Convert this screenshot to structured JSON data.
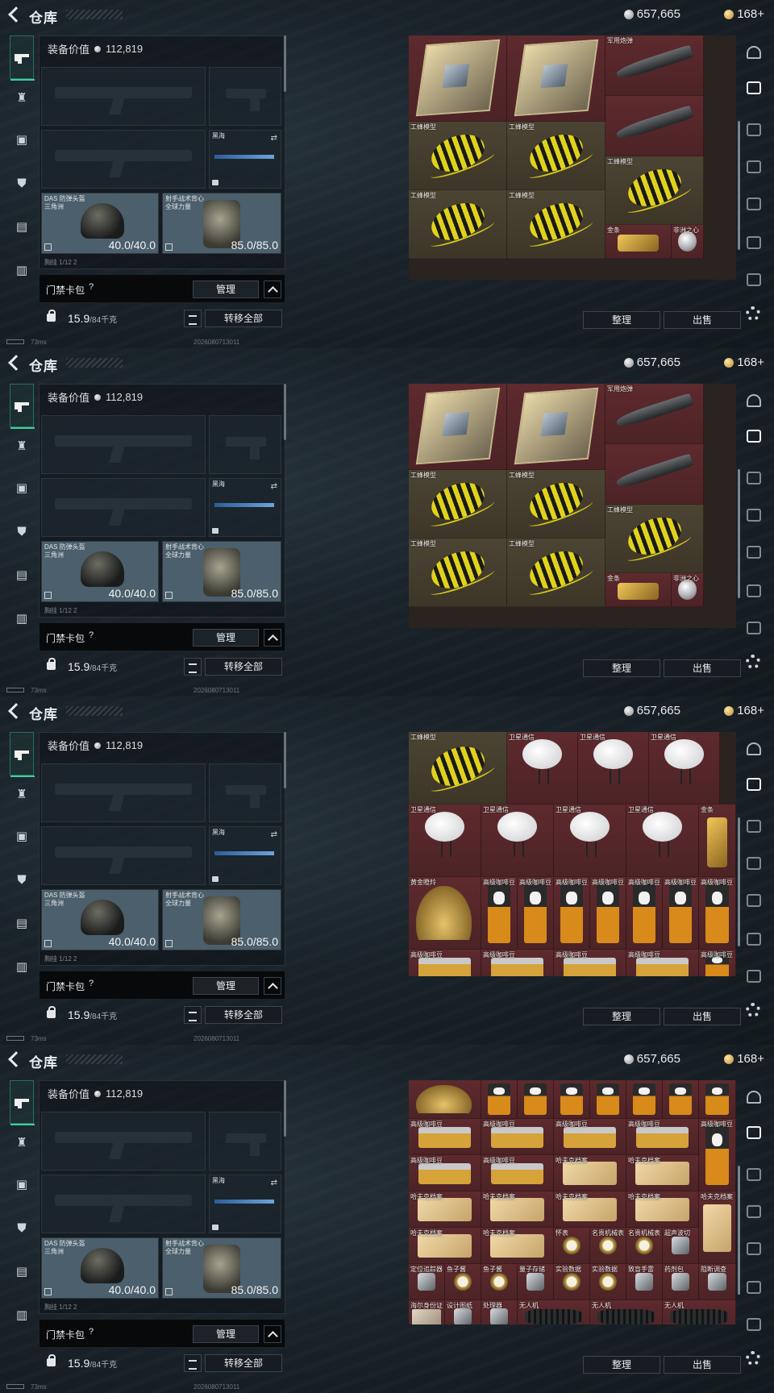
{
  "header": {
    "title": "仓库",
    "silver": "657,665",
    "gold": "168+"
  },
  "loadout": {
    "equip_value_label": "装备价值",
    "equip_value": "112,819",
    "melee_label": "黑海",
    "helmet_label": "DAS 防弹头盔\n三角洲",
    "helmet_durability": "40.0/40.0",
    "armor_label": "射手战术背心\n全球力量",
    "armor_durability": "85.0/85.0",
    "cut_row_text": "胸挂 1/12 2"
  },
  "gate": {
    "label": "门禁卡包",
    "help": "?",
    "manage": "管理"
  },
  "weight": {
    "value": "15.9",
    "max": "/84千克",
    "transfer": "转移全部"
  },
  "status": {
    "ping": "73ms",
    "build": "2026080713011"
  },
  "stash_buttons": {
    "sort": "整理",
    "sell": "出售"
  },
  "colors": {
    "accent": "#3fd0a0",
    "rarity_red": "#5e2a2e",
    "rarity_gold": "#4c4433"
  },
  "icons": {
    "left_nav": [
      "gun-icon",
      "backpack-icon",
      "chest-rig-icon",
      "armor-icon",
      "case-icon",
      "briefcase-icon"
    ],
    "right_rail": [
      "safebox-icon",
      "stash-tab-1-icon",
      "stash-tab-2-icon",
      "stash-tab-3-icon",
      "stash-tab-4-icon",
      "stash-tab-5-icon",
      "stash-tab-6-icon"
    ],
    "settings": "gear-icon"
  },
  "frames": [
    {
      "cells": [
        {
          "l": 0,
          "t": 0,
          "w": 122,
          "h": 107,
          "c": "red",
          "a": "cpu",
          "label": ""
        },
        {
          "l": 122,
          "t": 0,
          "w": 122,
          "h": 107,
          "c": "red",
          "a": "cpu",
          "label": ""
        },
        {
          "l": 244,
          "t": 0,
          "w": 122,
          "h": 75,
          "c": "red",
          "a": "missile",
          "label": "军用炮弹"
        },
        {
          "l": 244,
          "t": 75,
          "w": 122,
          "h": 75,
          "c": "red",
          "a": "missile",
          "label": ""
        },
        {
          "l": 0,
          "t": 107,
          "w": 122,
          "h": 85,
          "c": "gold",
          "a": "wasp",
          "label": "工蜂模型"
        },
        {
          "l": 122,
          "t": 107,
          "w": 122,
          "h": 85,
          "c": "gold",
          "a": "wasp",
          "label": "工蜂模型"
        },
        {
          "l": 244,
          "t": 150,
          "w": 122,
          "h": 85,
          "c": "gold",
          "a": "wasp",
          "label": "工蜂模型"
        },
        {
          "l": 0,
          "t": 192,
          "w": 122,
          "h": 85,
          "c": "gold",
          "a": "wasp",
          "label": "工蜂模型"
        },
        {
          "l": 122,
          "t": 192,
          "w": 122,
          "h": 85,
          "c": "gold",
          "a": "wasp",
          "label": "工蜂模型"
        },
        {
          "l": 244,
          "t": 235,
          "w": 82,
          "h": 42,
          "c": "red",
          "a": "goldbar",
          "label": "金条"
        },
        {
          "l": 326,
          "t": 235,
          "w": 40,
          "h": 42,
          "c": "red",
          "a": "diamond",
          "label": "非洲之心"
        }
      ]
    },
    {
      "cells": [
        {
          "l": 0,
          "t": 0,
          "w": 122,
          "h": 107,
          "c": "red",
          "a": "cpu",
          "label": ""
        },
        {
          "l": 122,
          "t": 0,
          "w": 122,
          "h": 107,
          "c": "red",
          "a": "cpu",
          "label": ""
        },
        {
          "l": 244,
          "t": 0,
          "w": 122,
          "h": 75,
          "c": "red",
          "a": "missile",
          "label": "军用炮弹"
        },
        {
          "l": 244,
          "t": 75,
          "w": 122,
          "h": 75,
          "c": "red",
          "a": "missile",
          "label": ""
        },
        {
          "l": 0,
          "t": 107,
          "w": 122,
          "h": 85,
          "c": "gold",
          "a": "wasp",
          "label": "工蜂模型"
        },
        {
          "l": 122,
          "t": 107,
          "w": 122,
          "h": 85,
          "c": "gold",
          "a": "wasp",
          "label": "工蜂模型"
        },
        {
          "l": 244,
          "t": 150,
          "w": 122,
          "h": 85,
          "c": "gold",
          "a": "wasp",
          "label": "工蜂模型"
        },
        {
          "l": 0,
          "t": 192,
          "w": 122,
          "h": 85,
          "c": "gold",
          "a": "wasp",
          "label": "工蜂模型"
        },
        {
          "l": 122,
          "t": 192,
          "w": 122,
          "h": 85,
          "c": "gold",
          "a": "wasp",
          "label": "工蜂模型"
        },
        {
          "l": 244,
          "t": 235,
          "w": 82,
          "h": 42,
          "c": "red",
          "a": "goldbar",
          "label": "金条"
        },
        {
          "l": 326,
          "t": 235,
          "w": 40,
          "h": 42,
          "c": "red",
          "a": "diamond",
          "label": "非洲之心"
        }
      ]
    },
    {
      "cells": [
        {
          "l": 0,
          "t": 0,
          "w": 122,
          "h": 90,
          "c": "gold",
          "a": "wasp",
          "label": "工蜂模型"
        },
        {
          "l": 122,
          "t": 0,
          "w": 88,
          "h": 90,
          "c": "red",
          "a": "dish",
          "label": "卫星通信"
        },
        {
          "l": 210,
          "t": 0,
          "w": 88,
          "h": 90,
          "c": "red",
          "a": "dish",
          "label": "卫星通信"
        },
        {
          "l": 298,
          "t": 0,
          "w": 88,
          "h": 90,
          "c": "red",
          "a": "dish",
          "label": "卫星通信"
        },
        {
          "l": 0,
          "t": 90,
          "w": 90,
          "h": 90,
          "c": "red",
          "a": "dish",
          "label": "卫星通信"
        },
        {
          "l": 90,
          "t": 90,
          "w": 90,
          "h": 90,
          "c": "red",
          "a": "dish",
          "label": "卫星通信"
        },
        {
          "l": 180,
          "t": 90,
          "w": 90,
          "h": 90,
          "c": "red",
          "a": "dish",
          "label": "卫星通信"
        },
        {
          "l": 270,
          "t": 90,
          "w": 90,
          "h": 90,
          "c": "red",
          "a": "dish",
          "label": "卫星通信"
        },
        {
          "l": 360,
          "t": 90,
          "w": 46,
          "h": 90,
          "c": "red",
          "a": "goldbar-v",
          "label": "金条"
        },
        {
          "l": 0,
          "t": 180,
          "w": 90,
          "h": 90,
          "c": "red",
          "a": "deer",
          "label": "黄金瞪羚"
        },
        {
          "l": 90,
          "t": 180,
          "w": 45,
          "h": 90,
          "c": "red",
          "a": "coffee",
          "label": "高级咖啡豆"
        },
        {
          "l": 135,
          "t": 180,
          "w": 45,
          "h": 90,
          "c": "red",
          "a": "coffee",
          "label": "高级咖啡豆"
        },
        {
          "l": 180,
          "t": 180,
          "w": 45,
          "h": 90,
          "c": "red",
          "a": "coffee",
          "label": "高级咖啡豆"
        },
        {
          "l": 225,
          "t": 180,
          "w": 45,
          "h": 90,
          "c": "red",
          "a": "coffee",
          "label": "高级咖啡豆"
        },
        {
          "l": 270,
          "t": 180,
          "w": 45,
          "h": 90,
          "c": "red",
          "a": "coffee",
          "label": "高级咖啡豆"
        },
        {
          "l": 315,
          "t": 180,
          "w": 45,
          "h": 90,
          "c": "red",
          "a": "coffee",
          "label": "高级咖啡豆"
        },
        {
          "l": 360,
          "t": 180,
          "w": 46,
          "h": 90,
          "c": "red",
          "a": "coffee",
          "label": "高级咖啡豆"
        },
        {
          "l": 0,
          "t": 270,
          "w": 90,
          "h": 45,
          "c": "red",
          "a": "box",
          "label": "高级咖啡豆"
        },
        {
          "l": 90,
          "t": 270,
          "w": 90,
          "h": 45,
          "c": "red",
          "a": "box",
          "label": "高级咖啡豆"
        },
        {
          "l": 180,
          "t": 270,
          "w": 90,
          "h": 45,
          "c": "red",
          "a": "box",
          "label": "高级咖啡豆"
        },
        {
          "l": 270,
          "t": 270,
          "w": 90,
          "h": 45,
          "c": "red",
          "a": "box",
          "label": "高级咖啡豆"
        },
        {
          "l": 360,
          "t": 270,
          "w": 46,
          "h": 45,
          "c": "red",
          "a": "coffee",
          "label": "高级咖啡豆"
        }
      ]
    },
    {
      "cells": [
        {
          "l": 0,
          "t": 0,
          "w": 90,
          "h": 48,
          "c": "red",
          "a": "deer",
          "label": ""
        },
        {
          "l": 90,
          "t": 0,
          "w": 45,
          "h": 48,
          "c": "red",
          "a": "coffee",
          "label": ""
        },
        {
          "l": 135,
          "t": 0,
          "w": 45,
          "h": 48,
          "c": "red",
          "a": "coffee",
          "label": ""
        },
        {
          "l": 180,
          "t": 0,
          "w": 45,
          "h": 48,
          "c": "red",
          "a": "coffee",
          "label": ""
        },
        {
          "l": 225,
          "t": 0,
          "w": 45,
          "h": 48,
          "c": "red",
          "a": "coffee",
          "label": ""
        },
        {
          "l": 270,
          "t": 0,
          "w": 45,
          "h": 48,
          "c": "red",
          "a": "coffee",
          "label": ""
        },
        {
          "l": 315,
          "t": 0,
          "w": 45,
          "h": 48,
          "c": "red",
          "a": "coffee",
          "label": ""
        },
        {
          "l": 360,
          "t": 0,
          "w": 46,
          "h": 48,
          "c": "red",
          "a": "coffee",
          "label": ""
        },
        {
          "l": 0,
          "t": 48,
          "w": 90,
          "h": 45,
          "c": "red",
          "a": "box",
          "label": "高级咖啡豆"
        },
        {
          "l": 90,
          "t": 48,
          "w": 90,
          "h": 45,
          "c": "red",
          "a": "box",
          "label": "高级咖啡豆"
        },
        {
          "l": 180,
          "t": 48,
          "w": 90,
          "h": 45,
          "c": "red",
          "a": "box",
          "label": "高级咖啡豆"
        },
        {
          "l": 270,
          "t": 48,
          "w": 90,
          "h": 45,
          "c": "red",
          "a": "box",
          "label": "高级咖啡豆"
        },
        {
          "l": 360,
          "t": 48,
          "w": 46,
          "h": 90,
          "c": "red",
          "a": "coffee",
          "label": "高级咖啡豆"
        },
        {
          "l": 0,
          "t": 93,
          "w": 90,
          "h": 45,
          "c": "red",
          "a": "box",
          "label": "高级咖啡豆"
        },
        {
          "l": 90,
          "t": 93,
          "w": 90,
          "h": 45,
          "c": "red",
          "a": "box",
          "label": "高级咖啡豆"
        },
        {
          "l": 180,
          "t": 93,
          "w": 90,
          "h": 45,
          "c": "red",
          "a": "parcel",
          "label": "哈夫克档案"
        },
        {
          "l": 270,
          "t": 93,
          "w": 90,
          "h": 45,
          "c": "red",
          "a": "parcel",
          "label": "哈夫克档案"
        },
        {
          "l": 0,
          "t": 138,
          "w": 90,
          "h": 45,
          "c": "red",
          "a": "parcel",
          "label": "哈夫克档案"
        },
        {
          "l": 90,
          "t": 138,
          "w": 90,
          "h": 45,
          "c": "red",
          "a": "parcel",
          "label": "哈夫克档案"
        },
        {
          "l": 180,
          "t": 138,
          "w": 90,
          "h": 45,
          "c": "red",
          "a": "parcel",
          "label": "哈夫克档案"
        },
        {
          "l": 270,
          "t": 138,
          "w": 90,
          "h": 45,
          "c": "red",
          "a": "parcel",
          "label": "哈夫克档案"
        },
        {
          "l": 360,
          "t": 138,
          "w": 46,
          "h": 90,
          "c": "red",
          "a": "parcel",
          "label": "哈夫克档案"
        },
        {
          "l": 0,
          "t": 183,
          "w": 90,
          "h": 45,
          "c": "red",
          "a": "parcel",
          "label": "哈夫克档案"
        },
        {
          "l": 90,
          "t": 183,
          "w": 90,
          "h": 45,
          "c": "red",
          "a": "parcel",
          "label": "哈夫克档案"
        },
        {
          "l": 180,
          "t": 183,
          "w": 45,
          "h": 45,
          "c": "red",
          "a": "watch",
          "label": "怀表"
        },
        {
          "l": 225,
          "t": 183,
          "w": 45,
          "h": 45,
          "c": "red",
          "a": "watch",
          "label": "名贵机械表"
        },
        {
          "l": 270,
          "t": 183,
          "w": 45,
          "h": 45,
          "c": "red",
          "a": "watch",
          "label": "名贵机械表"
        },
        {
          "l": 315,
          "t": 183,
          "w": 45,
          "h": 45,
          "c": "red",
          "a": "small",
          "label": "超声波切"
        },
        {
          "l": 0,
          "t": 228,
          "w": 45,
          "h": 45,
          "c": "red",
          "a": "small",
          "label": "定位追踪器"
        },
        {
          "l": 45,
          "t": 228,
          "w": 45,
          "h": 45,
          "c": "red",
          "a": "watch",
          "label": "鱼子酱"
        },
        {
          "l": 90,
          "t": 228,
          "w": 45,
          "h": 45,
          "c": "red",
          "a": "watch",
          "label": "鱼子酱"
        },
        {
          "l": 135,
          "t": 228,
          "w": 45,
          "h": 45,
          "c": "red",
          "a": "small",
          "label": "量子存储"
        },
        {
          "l": 180,
          "t": 228,
          "w": 45,
          "h": 45,
          "c": "red",
          "a": "watch",
          "label": "实验数据"
        },
        {
          "l": 225,
          "t": 228,
          "w": 45,
          "h": 45,
          "c": "red",
          "a": "watch",
          "label": "实验数据"
        },
        {
          "l": 270,
          "t": 228,
          "w": 45,
          "h": 45,
          "c": "red",
          "a": "small",
          "label": "致盲手雷"
        },
        {
          "l": 315,
          "t": 228,
          "w": 45,
          "h": 45,
          "c": "red",
          "a": "small",
          "label": "药剂包"
        },
        {
          "l": 360,
          "t": 228,
          "w": 46,
          "h": 45,
          "c": "red",
          "a": "small",
          "label": "阻断调查"
        },
        {
          "l": 0,
          "t": 273,
          "w": 45,
          "h": 42,
          "c": "red",
          "a": "card",
          "label": "海尔身份证"
        },
        {
          "l": 45,
          "t": 273,
          "w": 45,
          "h": 42,
          "c": "red",
          "a": "small",
          "label": "设计图纸"
        },
        {
          "l": 90,
          "t": 273,
          "w": 45,
          "h": 42,
          "c": "red",
          "a": "small",
          "label": "处理器"
        },
        {
          "l": 135,
          "t": 273,
          "w": 90,
          "h": 42,
          "c": "red",
          "a": "drone",
          "label": "无人机"
        },
        {
          "l": 225,
          "t": 273,
          "w": 90,
          "h": 42,
          "c": "red",
          "a": "drone",
          "label": "无人机"
        },
        {
          "l": 315,
          "t": 273,
          "w": 91,
          "h": 42,
          "c": "red",
          "a": "drone",
          "label": "无人机"
        }
      ]
    }
  ]
}
